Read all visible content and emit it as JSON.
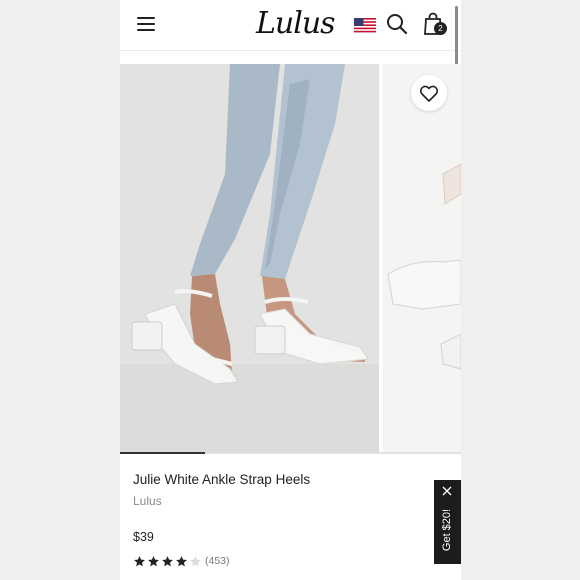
{
  "header": {
    "logo_text": "Lulus",
    "menu_icon": "hamburger-menu-icon",
    "flag_icon": "us-flag-icon",
    "search_icon": "search-icon",
    "cart_icon": "shopping-bag-icon",
    "cart_count": "2"
  },
  "gallery": {
    "image_count_visible": 2,
    "progress_fraction": 0.25,
    "wishlist_icon": "heart-icon"
  },
  "product": {
    "title": "Julie White Ankle Strap Heels",
    "brand": "Lulus",
    "price": "$39",
    "rating": 4,
    "rating_max": 5,
    "review_count": "(453)"
  },
  "promo": {
    "label": "Get $20!",
    "close_icon": "close-icon"
  },
  "colors": {
    "accent_dark": "#1c1c1c",
    "flag_red": "#c8102e",
    "flag_blue": "#3c3b6e"
  }
}
